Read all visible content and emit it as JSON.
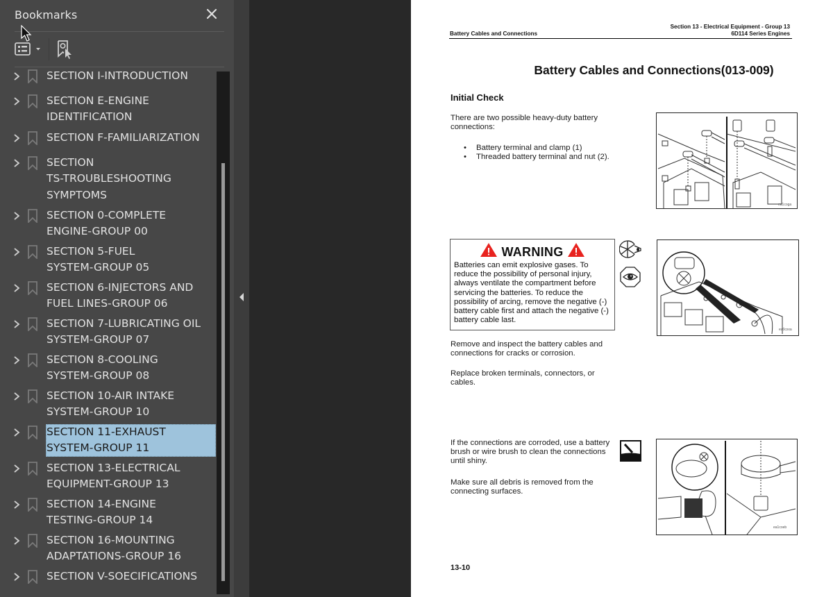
{
  "panel": {
    "title": "Bookmarks",
    "close_icon": "close-icon",
    "options_icon": "bookmark-options-icon",
    "find_icon": "find-current-bookmark-icon",
    "selected_index": 11,
    "items": [
      {
        "label": "SECTION I-INTRODUCTION"
      },
      {
        "label": "SECTION E-ENGINE\nIDENTIFICATION"
      },
      {
        "label": "SECTION F-FAMILIARIZATION"
      },
      {
        "label": "SECTION\nTS-TROUBLESHOOTING\nSYMPTOMS"
      },
      {
        "label": "SECTION 0-COMPLETE\nENGINE-GROUP 00"
      },
      {
        "label": "SECTION 5-FUEL\nSYSTEM-GROUP 05"
      },
      {
        "label": "SECTION 6-INJECTORS AND\nFUEL LINES-GROUP 06"
      },
      {
        "label": "SECTION 7-LUBRICATING OIL\nSYSTEM-GROUP 07"
      },
      {
        "label": "SECTION 8-COOLING\nSYSTEM-GROUP 08"
      },
      {
        "label": "SECTION 10-AIR INTAKE\nSYSTEM-GROUP 10"
      },
      {
        "label": "SECTION 11-EXHAUST\nSYSTEM-GROUP 11"
      },
      {
        "label": "SECTION 13-ELECTRICAL\nEQUIPMENT-GROUP 13"
      },
      {
        "label": "SECTION 14-ENGINE\nTESTING-GROUP 14"
      },
      {
        "label": "SECTION 16-MOUNTING\nADAPTATIONS-GROUP 16"
      },
      {
        "label": "SECTION V-SOECIFICATIONS"
      }
    ]
  },
  "colors": {
    "panel_bg": "#474747",
    "selection_bg": "#9ec3dc",
    "warning_red": "#e8231f"
  },
  "document": {
    "header_left": "Battery Cables and Connections",
    "header_right_line1": "Section 13 - Electrical Equipment - Group 13",
    "header_right_line2": "6D114 Series Engines",
    "heading": "Battery Cables and Connections(013-009)",
    "subheading": "Initial Check",
    "intro": "There are two possible heavy-duty battery connections:",
    "bullets": [
      "Battery terminal and clamp (1)",
      "Threaded battery terminal and nut (2)."
    ],
    "figure1_code": "ea1cogа",
    "warning_title": "WARNING",
    "warning_text": "Batteries can emit explosive gases. To reduce the possibility of personal injury, always ventilate the compartment before servicing the batteries. To reduce the possibility of arcing, remove the negative (-) battery cable first and attach the negative (-) battery cable last.",
    "remove_text": "Remove and inspect the battery cables and connections for cracks or corrosion.",
    "replace_text": "Replace broken terminals, connectors, or cables.",
    "corroded_text": "If the connections are corroded, use a battery brush or wire brush to clean the connections until shiny.",
    "debris_text": "Make sure all debris is removed from the connecting surfaces.",
    "page_number": "13-10"
  }
}
